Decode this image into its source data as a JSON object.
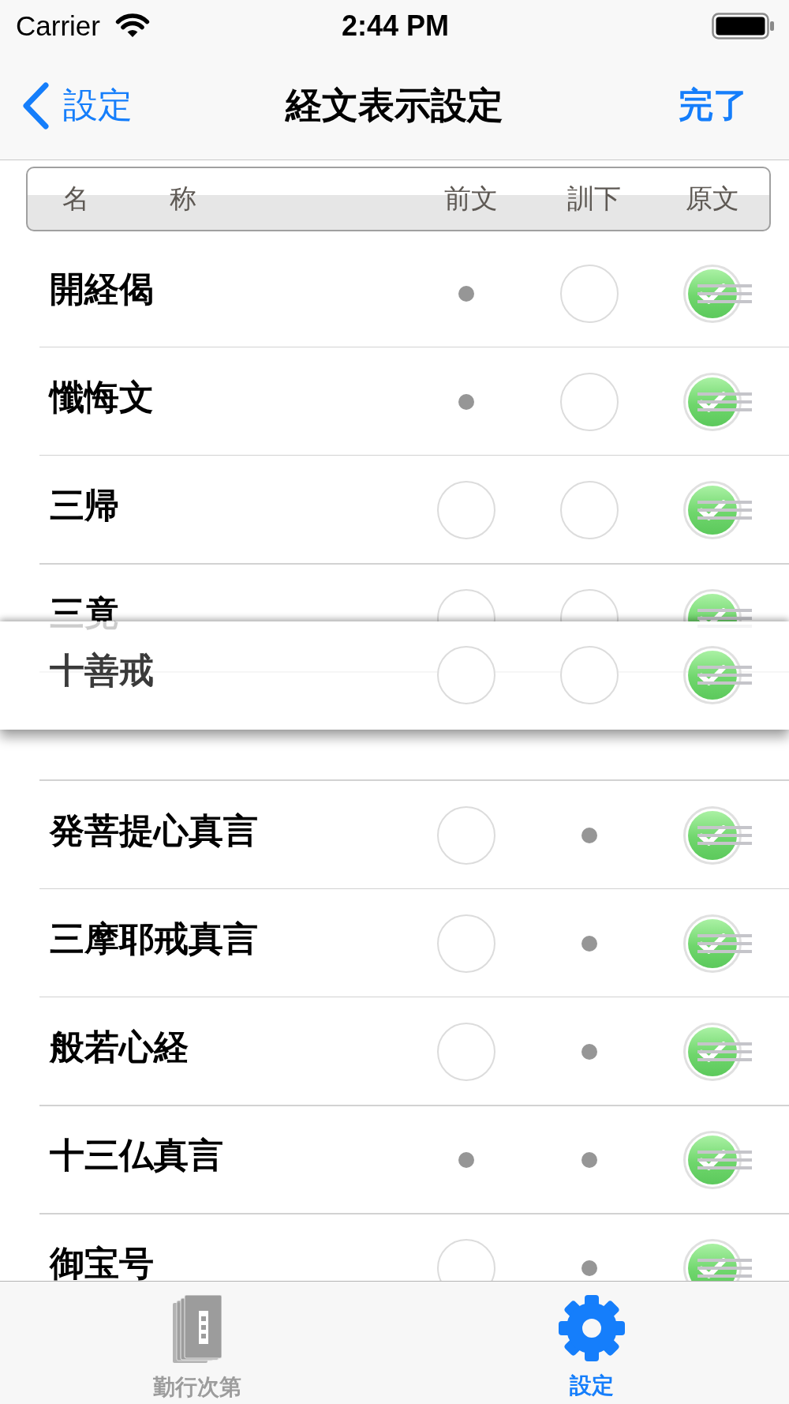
{
  "status_bar": {
    "carrier": "Carrier",
    "time": "2:44 PM"
  },
  "nav_bar": {
    "back": "設定",
    "title": "経文表示設定",
    "done": "完了"
  },
  "table_header": {
    "columns": [
      "名　　　称",
      "前文",
      "訓下",
      "原文"
    ]
  },
  "rows": [
    {
      "name": "開経偈",
      "dragging": false,
      "cells": [
        {
          "kind": "dot"
        },
        {
          "kind": "checkbox",
          "checked": false
        },
        {
          "kind": "checkbox",
          "checked": true
        }
      ]
    },
    {
      "name": "懺悔文",
      "dragging": false,
      "cells": [
        {
          "kind": "dot"
        },
        {
          "kind": "checkbox",
          "checked": false
        },
        {
          "kind": "checkbox",
          "checked": true
        }
      ]
    },
    {
      "name": "三帰",
      "dragging": false,
      "cells": [
        {
          "kind": "checkbox",
          "checked": false
        },
        {
          "kind": "checkbox",
          "checked": false
        },
        {
          "kind": "checkbox",
          "checked": true
        }
      ]
    },
    {
      "name": "三竟",
      "dragging": false,
      "cells": [
        {
          "kind": "checkbox",
          "checked": false
        },
        {
          "kind": "checkbox",
          "checked": false
        },
        {
          "kind": "checkbox",
          "checked": true
        }
      ]
    },
    {
      "name": "十善戒",
      "dragging": true,
      "cells": [
        {
          "kind": "checkbox",
          "checked": false
        },
        {
          "kind": "checkbox",
          "checked": false
        },
        {
          "kind": "checkbox",
          "checked": true
        }
      ]
    },
    {
      "name": "発菩提心真言",
      "dragging": false,
      "cells": [
        {
          "kind": "checkbox",
          "checked": false
        },
        {
          "kind": "dot"
        },
        {
          "kind": "checkbox",
          "checked": true
        }
      ]
    },
    {
      "name": "三摩耶戒真言",
      "dragging": false,
      "cells": [
        {
          "kind": "checkbox",
          "checked": false
        },
        {
          "kind": "dot"
        },
        {
          "kind": "checkbox",
          "checked": true
        }
      ]
    },
    {
      "name": "般若心経",
      "dragging": false,
      "cells": [
        {
          "kind": "checkbox",
          "checked": false
        },
        {
          "kind": "dot"
        },
        {
          "kind": "checkbox",
          "checked": true
        }
      ]
    },
    {
      "name": "十三仏真言",
      "dragging": false,
      "cells": [
        {
          "kind": "dot"
        },
        {
          "kind": "dot"
        },
        {
          "kind": "checkbox",
          "checked": true
        }
      ]
    },
    {
      "name": "御宝号",
      "dragging": false,
      "cells": [
        {
          "kind": "checkbox",
          "checked": false
        },
        {
          "kind": "dot"
        },
        {
          "kind": "checkbox",
          "checked": true
        }
      ]
    }
  ],
  "tab_bar": {
    "items": [
      {
        "label": "勤行次第",
        "selected": false
      },
      {
        "label": "設定",
        "selected": true
      }
    ]
  }
}
